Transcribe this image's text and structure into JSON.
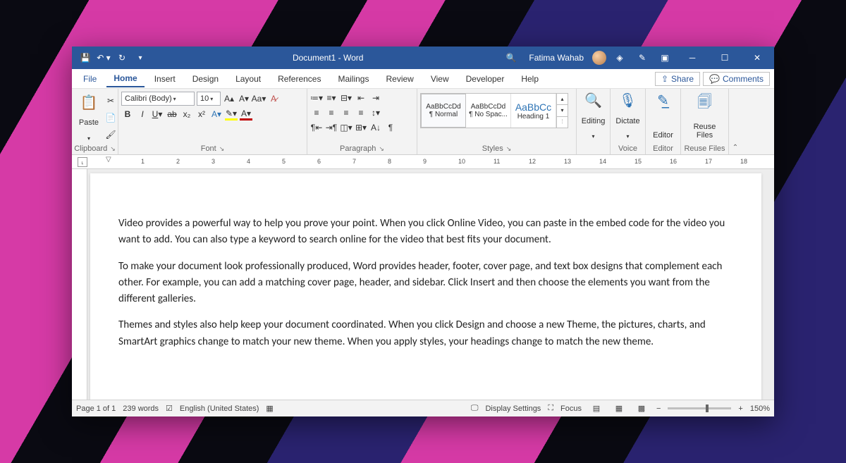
{
  "title": "Document1  -  Word",
  "user": "Fatima Wahab",
  "menu": {
    "file": "File",
    "home": "Home",
    "insert": "Insert",
    "design": "Design",
    "layout": "Layout",
    "references": "References",
    "mailings": "Mailings",
    "review": "Review",
    "view": "View",
    "developer": "Developer",
    "help": "Help",
    "share": "Share",
    "comments": "Comments"
  },
  "ribbon": {
    "clipboard": {
      "paste": "Paste",
      "label": "Clipboard"
    },
    "font": {
      "name": "Calibri (Body)",
      "size": "10",
      "label": "Font"
    },
    "paragraph": {
      "label": "Paragraph"
    },
    "styles": {
      "label": "Styles",
      "preview": "AaBbCcDd",
      "preview_big": "AaBbCc",
      "normal": "¶ Normal",
      "nospac": "¶ No Spac...",
      "heading1": "Heading 1"
    },
    "editing": {
      "label": "Editing"
    },
    "voice": {
      "label": "Voice",
      "dictate": "Dictate"
    },
    "editor": {
      "label": "Editor",
      "btn": "Editor"
    },
    "reuse": {
      "label": "Reuse Files",
      "btn": "Reuse\nFiles"
    }
  },
  "document": {
    "p1": "Video provides a powerful way to help you prove your point. When you click Online Video, you can paste in the embed code for the video you want to add. You can also type a keyword to search online for the video that best fits your document.",
    "p2": "To make your document look professionally produced, Word provides header, footer, cover page, and text box designs that complement each other. For example, you can add a matching cover page, header, and sidebar. Click Insert and then choose the elements you want from the different galleries.",
    "p3": "Themes and styles also help keep your document coordinated. When you click Design and choose a new Theme, the pictures, charts, and SmartArt graphics change to match your new theme. When you apply styles, your headings change to match the new theme."
  },
  "status": {
    "page": "Page 1 of 1",
    "words": "239 words",
    "lang": "English (United States)",
    "display": "Display Settings",
    "focus": "Focus",
    "zoom": "150%"
  },
  "ruler": [
    "1",
    "2",
    "3",
    "4",
    "5",
    "6",
    "7",
    "8",
    "9",
    "10",
    "11",
    "12",
    "13",
    "14",
    "15",
    "16",
    "17",
    "18"
  ]
}
